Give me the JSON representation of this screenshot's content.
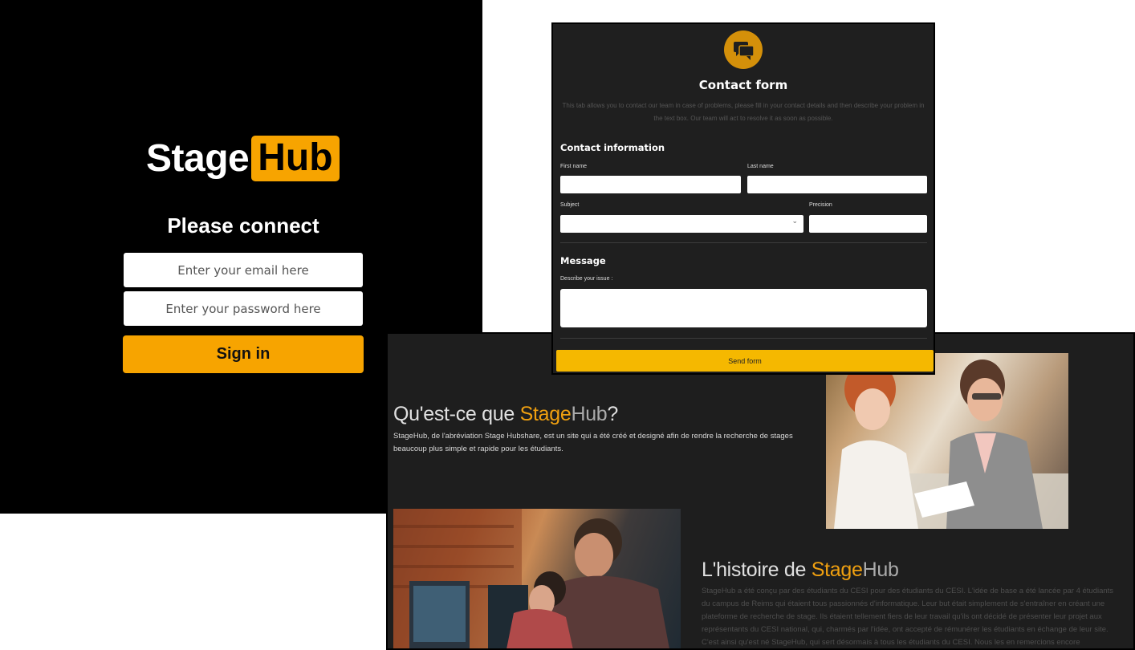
{
  "login": {
    "logo": {
      "part1": "Stage",
      "part2": "Hub"
    },
    "title": "Please connect",
    "email_placeholder": "Enter your email here",
    "password_placeholder": "Enter your password here",
    "signin_label": "Sign in"
  },
  "contact": {
    "icon": "chat-bubbles-icon",
    "title": "Contact form",
    "description": "This tab allows you to contact our team in case of problems, please fill in your contact details and then describe your problem in the text box. Our team will act to resolve it as soon as possible.",
    "contact_info_title": "Contact information",
    "first_name_label": "First name",
    "last_name_label": "Last name",
    "subject_label": "Subject",
    "precision_label": "Precision",
    "message_title": "Message",
    "issue_label": "Describe your issue :",
    "send_label": "Send form"
  },
  "about": {
    "heading1": {
      "prefix": "Qu'est-ce que ",
      "stage": "Stage",
      "hub": "Hub",
      "suffix": "?"
    },
    "paragraph1": "StageHub, de l'abréviation Stage Hubshare, est un site qui a été créé et designé afin de rendre la recherche de stages beaucoup plus simple et rapide pour les étudiants.",
    "heading2": {
      "prefix": "L'histoire de ",
      "stage": "Stage",
      "hub": "Hub"
    },
    "paragraph2": "StageHub a été conçu par des étudiants du CESI pour des étudiants du CESI. L'idée de base a été lancée par 4 étudiants du campus de Reims qui étaient tous passionnés d'informatique. Leur but était simplement de s'entraîner en créant une plateforme de recherche de stage. Ils étaient tellement fiers de leur travail qu'ils ont décidé de présenter leur projet aux représentants du CESI national, qui, charmés par l'idée, ont accepté de rémunérer les étudiants en échange de leur site. C'est ainsi qu'est né StageHub, qui sert désormais à tous les étudiants du CESI. Nous les en remercions encore aujourd'hui."
  },
  "colors": {
    "accent": "#f7a400",
    "background": "#000000",
    "panel": "#1f1f1f"
  }
}
